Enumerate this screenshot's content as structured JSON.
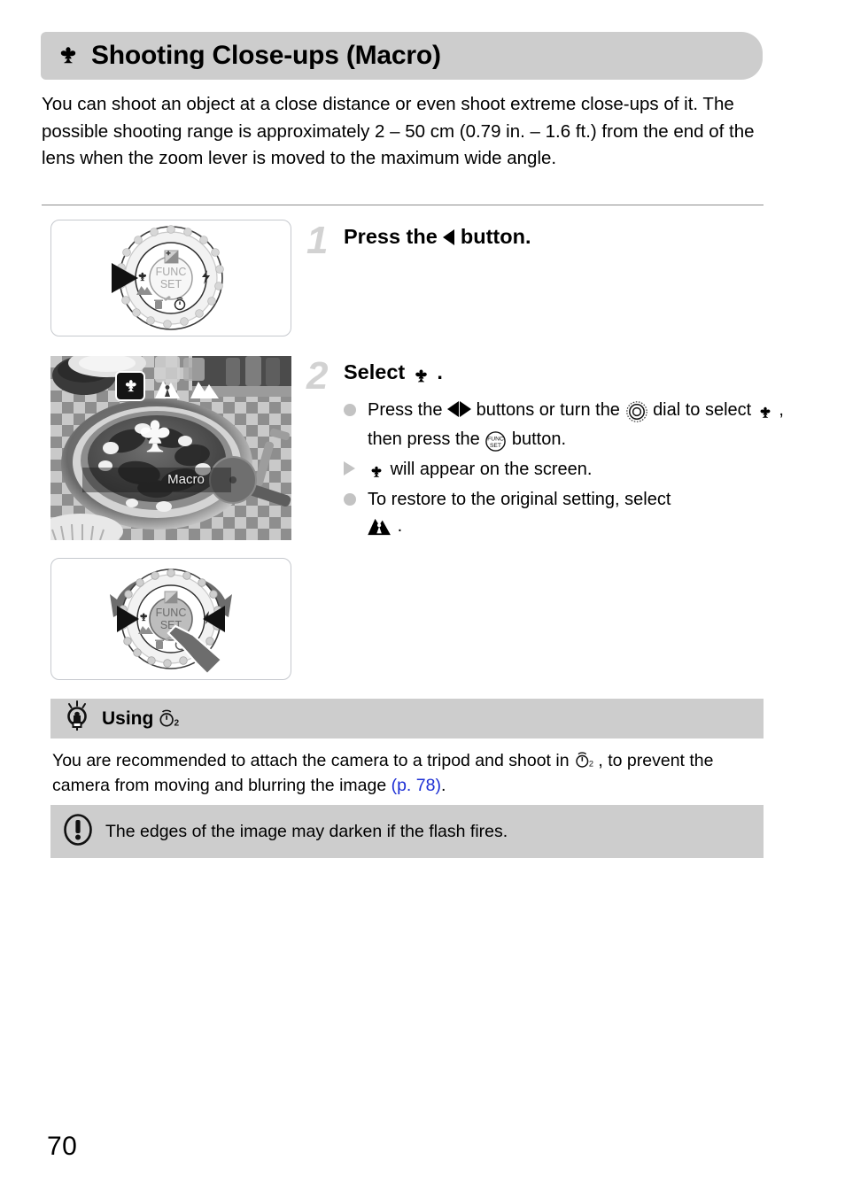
{
  "header": {
    "icon": "macro-flower-icon",
    "title": "Shooting Close-ups (Macro)"
  },
  "intro": {
    "text": "You can shoot an object at a close distance or even shoot extreme close-ups of it. The possible shooting range is approximately 2 – 50 cm (0.79 in. – 1.6 ft.) from the end of the lens when the zoom lever is moved to the maximum wide angle."
  },
  "steps": [
    {
      "number": "1",
      "heading_before": "Press the ",
      "heading_icon": "left-arrow-button-icon",
      "heading_after": " button.",
      "illustration": {
        "name": "camera-control-dial-press-left",
        "center_label_line1": "FUNC",
        "center_label_line2": "SET",
        "dial_icons": [
          "exposure-compensation-icon",
          "macro-icon",
          "landscape-icon",
          "flash-icon",
          "delete-icon",
          "self-timer-icon"
        ],
        "cursor": "left-arrow-highlight"
      },
      "bullets": []
    },
    {
      "number": "2",
      "heading_before": "Select ",
      "heading_icon": "macro-flower-icon",
      "heading_after": ".",
      "illustration": {
        "name": "camera-control-dial-turn-and-press",
        "center_label_line1": "FUNC",
        "center_label_line2": "SET",
        "cursor": "hand-pointer-icon"
      },
      "bullets": [
        {
          "marker": "dot",
          "parts": [
            {
              "type": "text",
              "value": "Press the "
            },
            {
              "type": "icon",
              "value": "left-right-arrows-icon"
            },
            {
              "type": "text",
              "value": " buttons or turn the "
            },
            {
              "type": "icon",
              "value": "control-dial-icon"
            },
            {
              "type": "text",
              "value": " dial to select "
            },
            {
              "type": "icon",
              "value": "macro-flower-icon"
            },
            {
              "type": "text",
              "value": ", then press the "
            },
            {
              "type": "icon",
              "value": "func-set-button-icon"
            },
            {
              "type": "text",
              "value": " button."
            }
          ]
        },
        {
          "marker": "triangle",
          "parts": [
            {
              "type": "icon",
              "value": "macro-flower-icon"
            },
            {
              "type": "text",
              "value": " will appear on the screen."
            }
          ]
        },
        {
          "marker": "dot",
          "parts": [
            {
              "type": "text",
              "value": "To restore to the original setting, select "
            },
            {
              "type": "icon",
              "value": "auto-macro-icon"
            },
            {
              "type": "text",
              "value": " ."
            }
          ]
        }
      ]
    }
  ],
  "screen_preview": {
    "name": "camera-lcd-preview",
    "mode_label": "Macro",
    "options": [
      {
        "name": "macro-icon",
        "selected": true
      },
      {
        "name": "auto-macro-icon",
        "selected": false
      },
      {
        "name": "infinity-landscape-icon",
        "selected": false
      }
    ],
    "overlay_icon": "macro-flower-large-icon"
  },
  "tip": {
    "icon": "lightbulb-icon",
    "title": "Using",
    "title_icon": "self-timer-2sec-icon",
    "body_before": "You are recommended to attach the camera to a tripod and shoot in ",
    "body_icon": "self-timer-2sec-icon",
    "body_middle": ", to prevent the camera from moving and blurring the image ",
    "page_ref": "(p. 78)",
    "body_after": "."
  },
  "warning": {
    "icon": "exclamation-circle-icon",
    "text": "The edges of the image may darken if the flash fires."
  },
  "folio": "70",
  "colors": {
    "banner_gray": "#cdcdcd",
    "step_number_gray": "#d2d2d2",
    "bullet_gray": "#c3c3c3",
    "link_blue": "#1d2fd4",
    "rule_gray": "#8c8c8c"
  }
}
